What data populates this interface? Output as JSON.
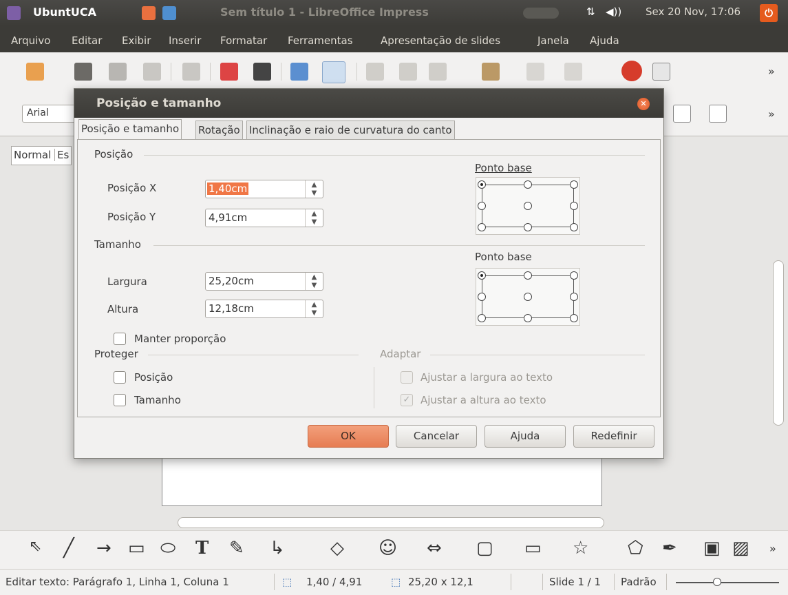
{
  "panel": {
    "app_name": "UbuntUCA",
    "window_title": "Sem título 1 - LibreOffice Impress",
    "clock": "Sex 20 Nov, 17:06"
  },
  "menu": [
    "Arquivo",
    "Editar",
    "Exibir",
    "Inserir",
    "Formatar",
    "Ferramentas",
    "Apresentação de slides",
    "Janela",
    "Ajuda"
  ],
  "font_box": {
    "value": "Arial"
  },
  "view_tab": {
    "label": "Normal",
    "label2": "Es"
  },
  "dialog": {
    "title": "Posição e tamanho",
    "tabs": [
      "Posição e tamanho",
      "Rotação",
      "Inclinação e raio de curvatura do canto"
    ],
    "position": {
      "group": "Posição",
      "x_label": "Posição X",
      "x_value": "1,40cm",
      "y_label": "Posição Y",
      "y_value": "4,91cm",
      "base_point": "Ponto base"
    },
    "size": {
      "group": "Tamanho",
      "width_label": "Largura",
      "width_value": "25,20cm",
      "height_label": "Altura",
      "height_value": "12,18cm",
      "base_point": "Ponto base",
      "keep_ratio": "Manter proporção"
    },
    "protect": {
      "group": "Proteger",
      "position": "Posição",
      "size": "Tamanho"
    },
    "adapt": {
      "group": "Adaptar",
      "fit_width": "Ajustar a largura ao texto",
      "fit_height": "Ajustar a altura ao texto"
    },
    "buttons": {
      "ok": "OK",
      "cancel": "Cancelar",
      "help": "Ajuda",
      "reset": "Redefinir"
    }
  },
  "status": {
    "edit": "Editar texto: Parágrafo 1, Linha 1, Coluna 1",
    "position": "1,40 / 4,91",
    "size": "25,20 x 12,1",
    "slide": "Slide 1 / 1",
    "layout": "Padrão"
  },
  "colors": {
    "accent": "#f07746",
    "panel": "#3c3b37"
  }
}
